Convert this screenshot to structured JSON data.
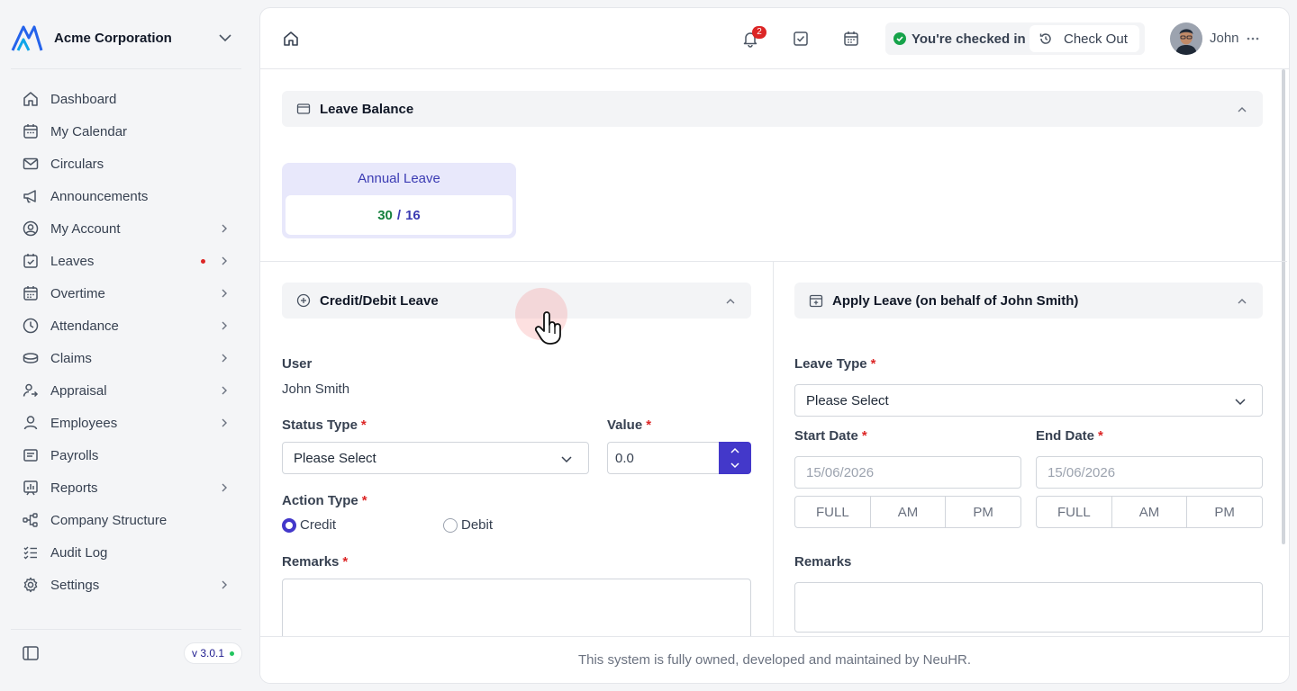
{
  "org": {
    "name": "Acme Corporation"
  },
  "nav": [
    {
      "label": "Dashboard",
      "icon": "home-icon",
      "chevron": false
    },
    {
      "label": "My Calendar",
      "icon": "calendar-icon",
      "chevron": false
    },
    {
      "label": "Circulars",
      "icon": "mail-icon",
      "chevron": false
    },
    {
      "label": "Announcements",
      "icon": "megaphone-icon",
      "chevron": false
    },
    {
      "label": "My Account",
      "icon": "user-circle-icon",
      "chevron": true
    },
    {
      "label": "Leaves",
      "icon": "calendar-check-icon",
      "chevron": true,
      "dot": true
    },
    {
      "label": "Overtime",
      "icon": "calendar-clock-icon",
      "chevron": true
    },
    {
      "label": "Attendance",
      "icon": "clock-icon",
      "chevron": true
    },
    {
      "label": "Claims",
      "icon": "coins-icon",
      "chevron": true
    },
    {
      "label": "Appraisal",
      "icon": "user-star-icon",
      "chevron": true
    },
    {
      "label": "Employees",
      "icon": "user-icon",
      "chevron": true
    },
    {
      "label": "Payrolls",
      "icon": "receipt-icon",
      "chevron": false
    },
    {
      "label": "Reports",
      "icon": "report-icon",
      "chevron": true
    },
    {
      "label": "Company Structure",
      "icon": "hierarchy-icon",
      "chevron": false
    },
    {
      "label": "Audit Log",
      "icon": "list-check-icon",
      "chevron": false
    },
    {
      "label": "Settings",
      "icon": "gear-icon",
      "chevron": true
    }
  ],
  "version": "v 3.0.1",
  "topbar": {
    "notification_count": "2",
    "checkin_status": "You're checked in",
    "checkout_label": "Check Out",
    "user_name": "John"
  },
  "leave_balance": {
    "title": "Leave Balance",
    "card_title": "Annual Leave",
    "used": "30",
    "separator": "/",
    "total": "16"
  },
  "credit_debit": {
    "title": "Credit/Debit Leave",
    "user_label": "User",
    "user_value": "John Smith",
    "status_type_label": "Status Type",
    "status_type_value": "Please Select",
    "value_label": "Value",
    "value": "0.0",
    "action_type_label": "Action Type",
    "option_credit": "Credit",
    "option_debit": "Debit",
    "selected_action": "Credit",
    "remarks_label": "Remarks",
    "required_mark": "*"
  },
  "apply_leave": {
    "title": "Apply Leave (on behalf of John Smith)",
    "leave_type_label": "Leave Type",
    "leave_type_value": "Please Select",
    "start_date_label": "Start Date",
    "start_date_placeholder": "15/06/2026",
    "end_date_label": "End Date",
    "end_date_placeholder": "15/06/2026",
    "segments": [
      "FULL",
      "AM",
      "PM"
    ],
    "remarks_label": "Remarks",
    "required_mark": "*"
  },
  "footer": {
    "text": "This system is fully owned, developed and maintained by NeuHR."
  },
  "colors": {
    "accent": "#4338ca",
    "danger": "#dc2626",
    "success": "#16a34a"
  }
}
